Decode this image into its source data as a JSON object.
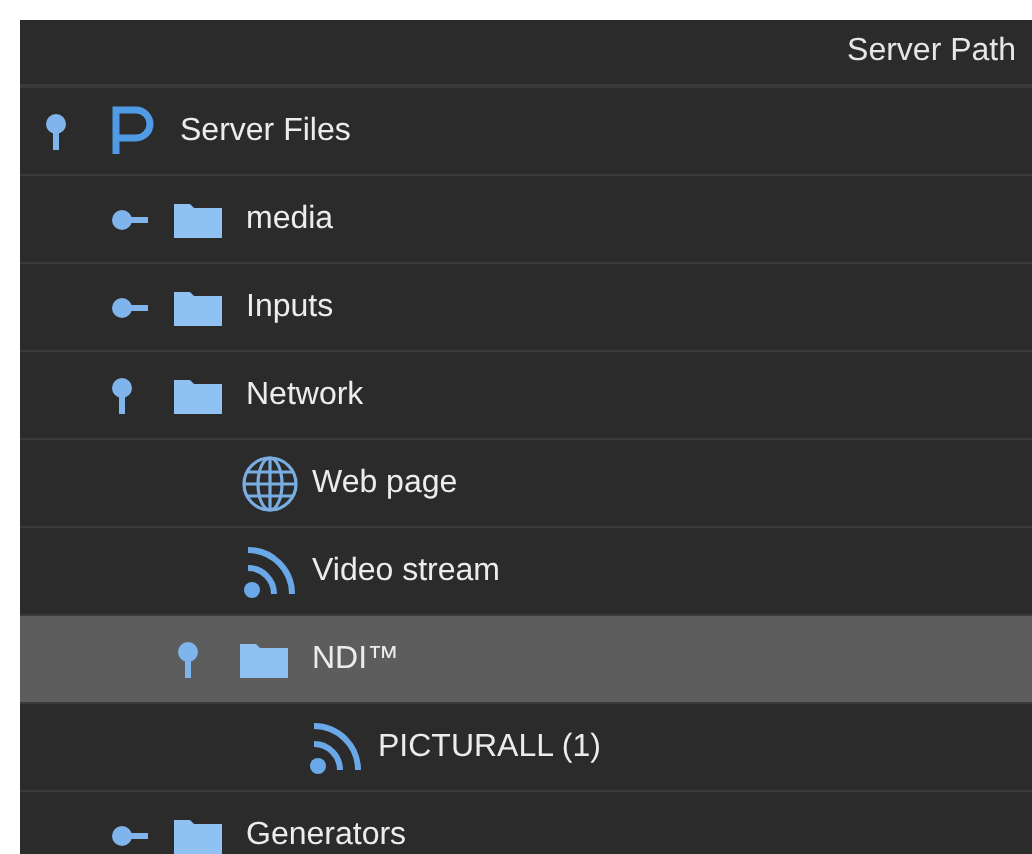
{
  "header": {
    "column": "Server Path"
  },
  "tree": [
    {
      "label": "Server Files",
      "kind": "root",
      "expanded": true,
      "selected": false,
      "children": [
        {
          "label": "media",
          "kind": "folder",
          "expanded": false,
          "selected": false
        },
        {
          "label": "Inputs",
          "kind": "folder",
          "expanded": false,
          "selected": false
        },
        {
          "label": "Network",
          "kind": "folder",
          "expanded": true,
          "selected": false,
          "children": [
            {
              "label": "Web page",
              "kind": "web",
              "selected": false
            },
            {
              "label": "Video stream",
              "kind": "stream",
              "selected": false
            },
            {
              "label": "NDI™",
              "kind": "folder",
              "expanded": true,
              "selected": true,
              "children": [
                {
                  "label": "PICTURALL (1)",
                  "kind": "stream",
                  "selected": false
                }
              ]
            }
          ]
        },
        {
          "label": "Generators",
          "kind": "folder",
          "expanded": false,
          "selected": false
        }
      ]
    }
  ]
}
